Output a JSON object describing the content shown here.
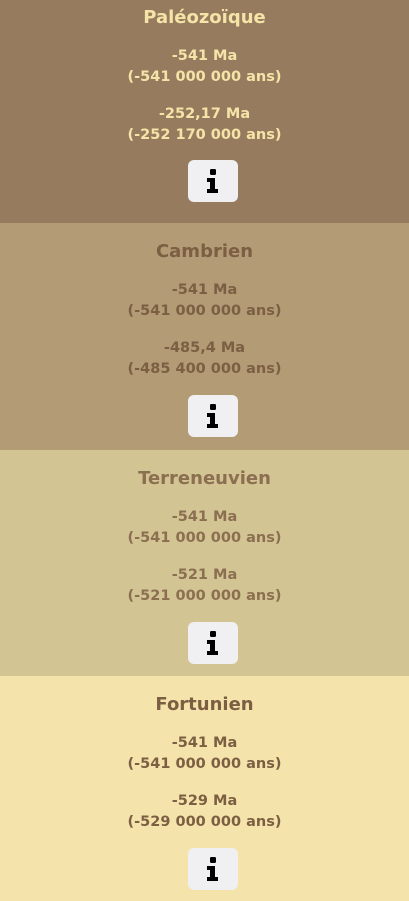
{
  "periods": [
    {
      "name": "Paléozoïque",
      "start_ma": "-541 Ma",
      "start_years": "(-541 000 000 ans)",
      "end_ma": "-252,17 Ma",
      "end_years": "(-252 170 000 ans)",
      "icon": "info-icon",
      "colors": {
        "background": "#977b5e",
        "text": "#f5e4a8"
      }
    },
    {
      "name": "Cambrien",
      "start_ma": "-541 Ma",
      "start_years": "(-541 000 000 ans)",
      "end_ma": "-485,4 Ma",
      "end_years": "(-485 400 000 ans)",
      "icon": "info-icon",
      "colors": {
        "background": "#b39b76",
        "text": "#7c5f43"
      }
    },
    {
      "name": "Terreneuvien",
      "start_ma": "-541 Ma",
      "start_years": "(-541 000 000 ans)",
      "end_ma": "-521 Ma",
      "end_years": "(-521 000 000 ans)",
      "icon": "info-icon",
      "colors": {
        "background": "#d3c494",
        "text": "#8b6f50"
      }
    },
    {
      "name": "Fortunien",
      "start_ma": "-541 Ma",
      "start_years": "(-541 000 000 ans)",
      "end_ma": "-529 Ma",
      "end_years": "(-529 000 000 ans)",
      "icon": "info-icon",
      "colors": {
        "background": "#f4e4ab",
        "text": "#7c5f43"
      }
    }
  ]
}
